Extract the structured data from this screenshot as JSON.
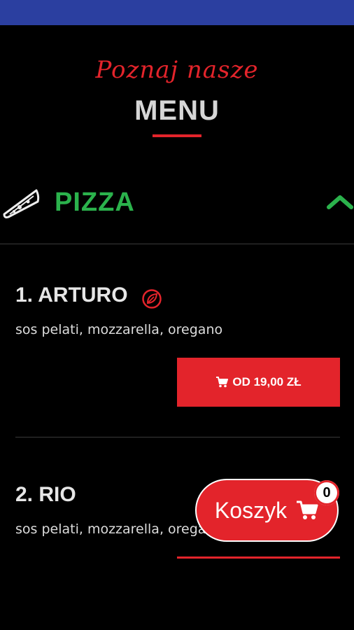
{
  "header": {
    "script_title": "Poznaj nasze",
    "title": "MENU"
  },
  "category": {
    "label": "PIZZA",
    "icon": "pizza-slice-icon",
    "toggle_icon": "chevron-up-icon",
    "accent_color": "#2bb24c"
  },
  "items": [
    {
      "name": "1. ARTURO",
      "description": "sos pelati, mozzarella, oregano",
      "badge_icon": "leaf-icon",
      "price_label": "OD 19,00 ZŁ"
    },
    {
      "name": "2. RIO",
      "description": "sos pelati, mozzarella, oregano"
    }
  ],
  "cart": {
    "label": "Koszyk",
    "count": "0",
    "icon": "cart-icon"
  },
  "colors": {
    "status_bar": "#2b3fa0",
    "brand_red": "#e3242b",
    "background": "#000000"
  }
}
